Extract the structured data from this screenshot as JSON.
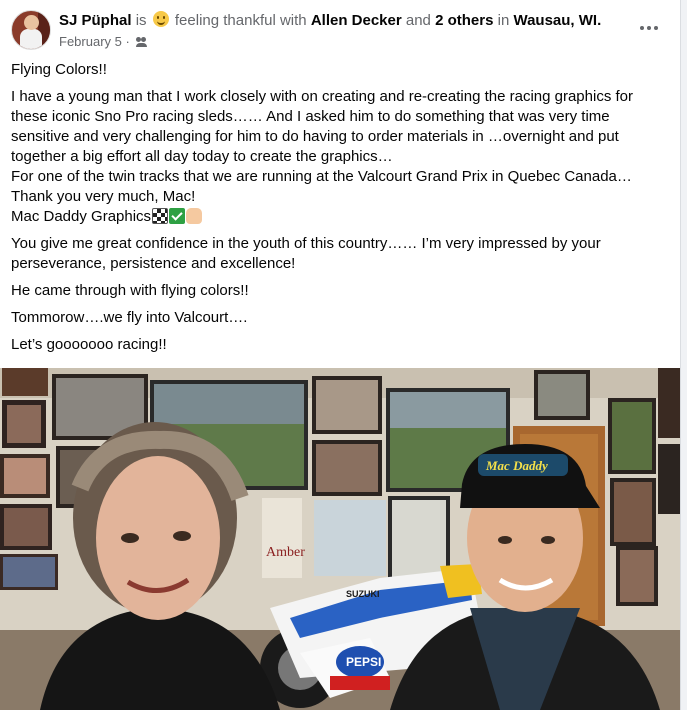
{
  "post": {
    "author": "SJ Püphal",
    "is_word": "is",
    "feeling": "feeling thankful with",
    "tagged_person": "Allen Decker",
    "and_word": "and",
    "others": "2 others",
    "in_word": "in",
    "location": "Wausau, WI.",
    "date": "February 5",
    "separator": "·",
    "paragraphs": {
      "p1": "Flying Colors!!",
      "p2": "I have a young man that I work closely with on creating and re-creating the racing graphics for these iconic Sno Pro racing sleds…… And I asked him to do something that was very time sensitive and very challenging for him to do having to order materials in …overnight and put together a big effort all day today to create the graphics…\nFor one of the twin tracks that we are running at the Valcourt Grand Prix in Quebec Canada…\nThank you very much, Mac!\nMac Daddy Graphics",
      "p3": "You give me great confidence in the youth of this country…… I’m very impressed by your perseverance, persistence and excellence!",
      "p4": "He came through with flying colors!!",
      "p5": "Tommorow….we fly into Valcourt….",
      "p6": "Let’s gooooooo racing!!"
    }
  },
  "icons": {
    "feeling": "smiling-face-icon",
    "audience": "friends-icon",
    "more": "more-options-icon",
    "emojis": [
      "checkered-flag-icon",
      "check-mark-icon",
      "fist-bump-icon"
    ]
  },
  "photo": {
    "cap_text": "Mac Daddy",
    "bike_text_1": "SUZUKI",
    "bike_text_2": "PEPSI",
    "poster_text": "Amber"
  }
}
